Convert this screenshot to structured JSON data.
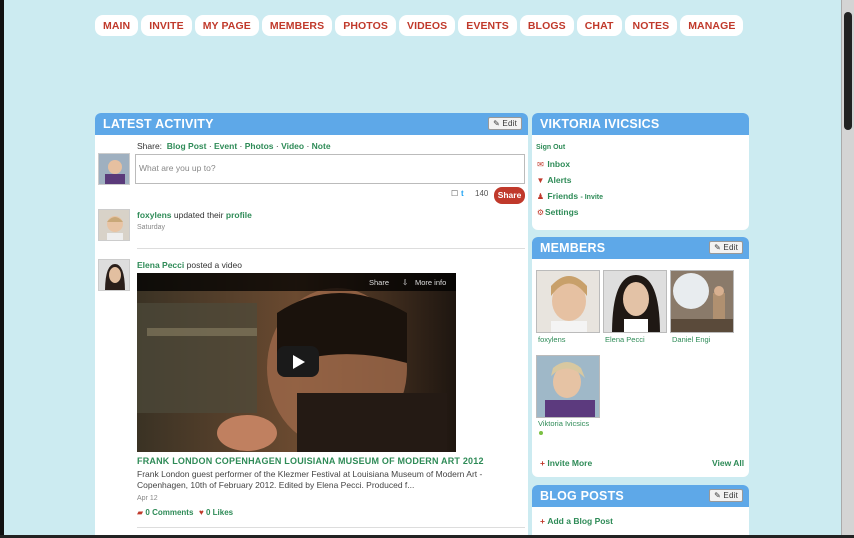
{
  "nav": {
    "tabs": [
      "MAIN",
      "INVITE",
      "MY PAGE",
      "MEMBERS",
      "PHOTOS",
      "VIDEOS",
      "EVENTS",
      "BLOGS",
      "CHAT",
      "NOTES",
      "MANAGE"
    ]
  },
  "activity": {
    "title": "LATEST ACTIVITY",
    "edit_label": "Edit",
    "share_label": "Share:",
    "share_links": [
      "Blog Post",
      "Event",
      "Photos",
      "Video",
      "Note"
    ],
    "status_placeholder": "What are you up to?",
    "char_count": "140",
    "share_button": "Share",
    "feed": [
      {
        "user": "foxylens",
        "action": "updated their",
        "link": "profile",
        "time": "Saturday"
      },
      {
        "user": "Elena Pecci",
        "action": "posted a video",
        "time": "Apr 12",
        "video": {
          "share": "Share",
          "more_info": "More info",
          "title": "FRANK LONDON COPENHAGEN LOUISIANA MUSEUM OF MODERN ART 2012",
          "description": "Frank London guest performer of the Klezmer Festival at Louisiana Museum of Modern Art - Copenhagen, 10th of February 2012. Edited by Elena Pecci. Produced f...",
          "comments": "0 Comments",
          "likes": "0 Likes"
        }
      }
    ]
  },
  "profile": {
    "name": "VIKTORIA IVICSICS",
    "sign_out": "Sign Out",
    "inbox": "Inbox",
    "alerts": "Alerts",
    "friends": "Friends",
    "invite": "Invite",
    "settings": "Settings"
  },
  "members": {
    "title": "MEMBERS",
    "edit_label": "Edit",
    "list": [
      "foxylens",
      "Elena Pecci",
      "Daniel Engi",
      "Viktoria Ivicsics"
    ],
    "invite_more": "Invite More",
    "view_all": "View All"
  },
  "blogs": {
    "title": "BLOG POSTS",
    "edit_label": "Edit",
    "add": "Add a Blog Post"
  },
  "colors": {
    "header": "#5ea8e8",
    "accent_red": "#c0392b",
    "link_green": "#2e8b57",
    "background": "#ccebf1"
  }
}
